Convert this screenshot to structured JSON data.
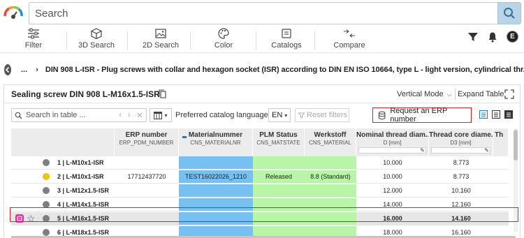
{
  "search": {
    "placeholder": "Search"
  },
  "toolbar": {
    "items": [
      {
        "label": "Filter",
        "icon": "sliders-icon"
      },
      {
        "label": "3D Search",
        "icon": "cube-icon"
      },
      {
        "label": "2D Search",
        "icon": "image-icon"
      },
      {
        "label": "Color",
        "icon": "palette-icon"
      },
      {
        "label": "Catalogs",
        "icon": "catalog-icon"
      },
      {
        "label": "Compare",
        "icon": "compare-arrows-icon"
      }
    ],
    "user_initial": "E"
  },
  "breadcrumb": {
    "ellipsis": "...",
    "current": "DIN 908 L-ISR - Plug screws with collar and hexagon socket (ISR) according to DIN EN ISO 10664, type L - light version, cylindrical thr..."
  },
  "panel": {
    "title": "Sealing screw DIN 908 L-M16x1.5-ISR",
    "vertical_mode": "Vertical Mode",
    "expand_table": "Expand Table"
  },
  "filters": {
    "table_search_placeholder": "Search in table ...",
    "preferred_language_label": "Preferred catalog language",
    "language": "EN",
    "reset_filters": "Reset filters",
    "request_erp": "Request an ERP number"
  },
  "table": {
    "headers": [
      {
        "title": "ERP number",
        "sub": "ERP_PDM_NUMBER"
      },
      {
        "title": "Materialnummer",
        "sub": "CNS_MATERIALNR"
      },
      {
        "title": "PLM Status",
        "sub": "CNS_MATSTATE"
      },
      {
        "title": "Werkstoff",
        "sub": "CNS_MATERIAL"
      },
      {
        "title": "Nominal thread diam...",
        "sub": "D [mm]"
      },
      {
        "title": "Thread core diame...",
        "sub": "D3 [mm]"
      },
      {
        "title": "Th",
        "sub": ""
      }
    ],
    "rows": [
      {
        "name": "1 | L-M10x1-ISR",
        "erp": "",
        "mat": "",
        "plm": "",
        "werk": "",
        "d": "10.000",
        "d3": "8.773",
        "status": "grey"
      },
      {
        "name": "2 | L-M10x1-ISR",
        "erp": "17712437720",
        "mat": "TEST16022026_1210",
        "plm": "Released",
        "werk": "8.8 (Standard)",
        "d": "10.000",
        "d3": "8.773",
        "status": "yellow"
      },
      {
        "name": "3 | L-M12x1.5-ISR",
        "erp": "",
        "mat": "",
        "plm": "",
        "werk": "",
        "d": "12.000",
        "d3": "10.160",
        "status": "grey"
      },
      {
        "name": "4 | L-M14x1.5-ISR",
        "erp": "",
        "mat": "",
        "plm": "",
        "werk": "",
        "d": "14.000",
        "d3": "12.160",
        "status": "grey"
      },
      {
        "name": "5 | L-M16x1.5-ISR",
        "erp": "",
        "mat": "",
        "plm": "",
        "werk": "",
        "d": "16.000",
        "d3": "14.160",
        "status": "grey",
        "selected": true
      },
      {
        "name": "6 | L-M18x1.5-ISR",
        "erp": "",
        "mat": "",
        "plm": "",
        "werk": "",
        "d": "18.000",
        "d3": "16.160",
        "status": "grey"
      }
    ]
  },
  "colors": {
    "accent_red": "#d8232a",
    "materialnr_blue": "#77c0f2",
    "plm_green": "#b9f5a6",
    "search_button": "#b9d4e8",
    "status_yellow": "#f1c500",
    "status_grey": "#7e7e7e"
  }
}
